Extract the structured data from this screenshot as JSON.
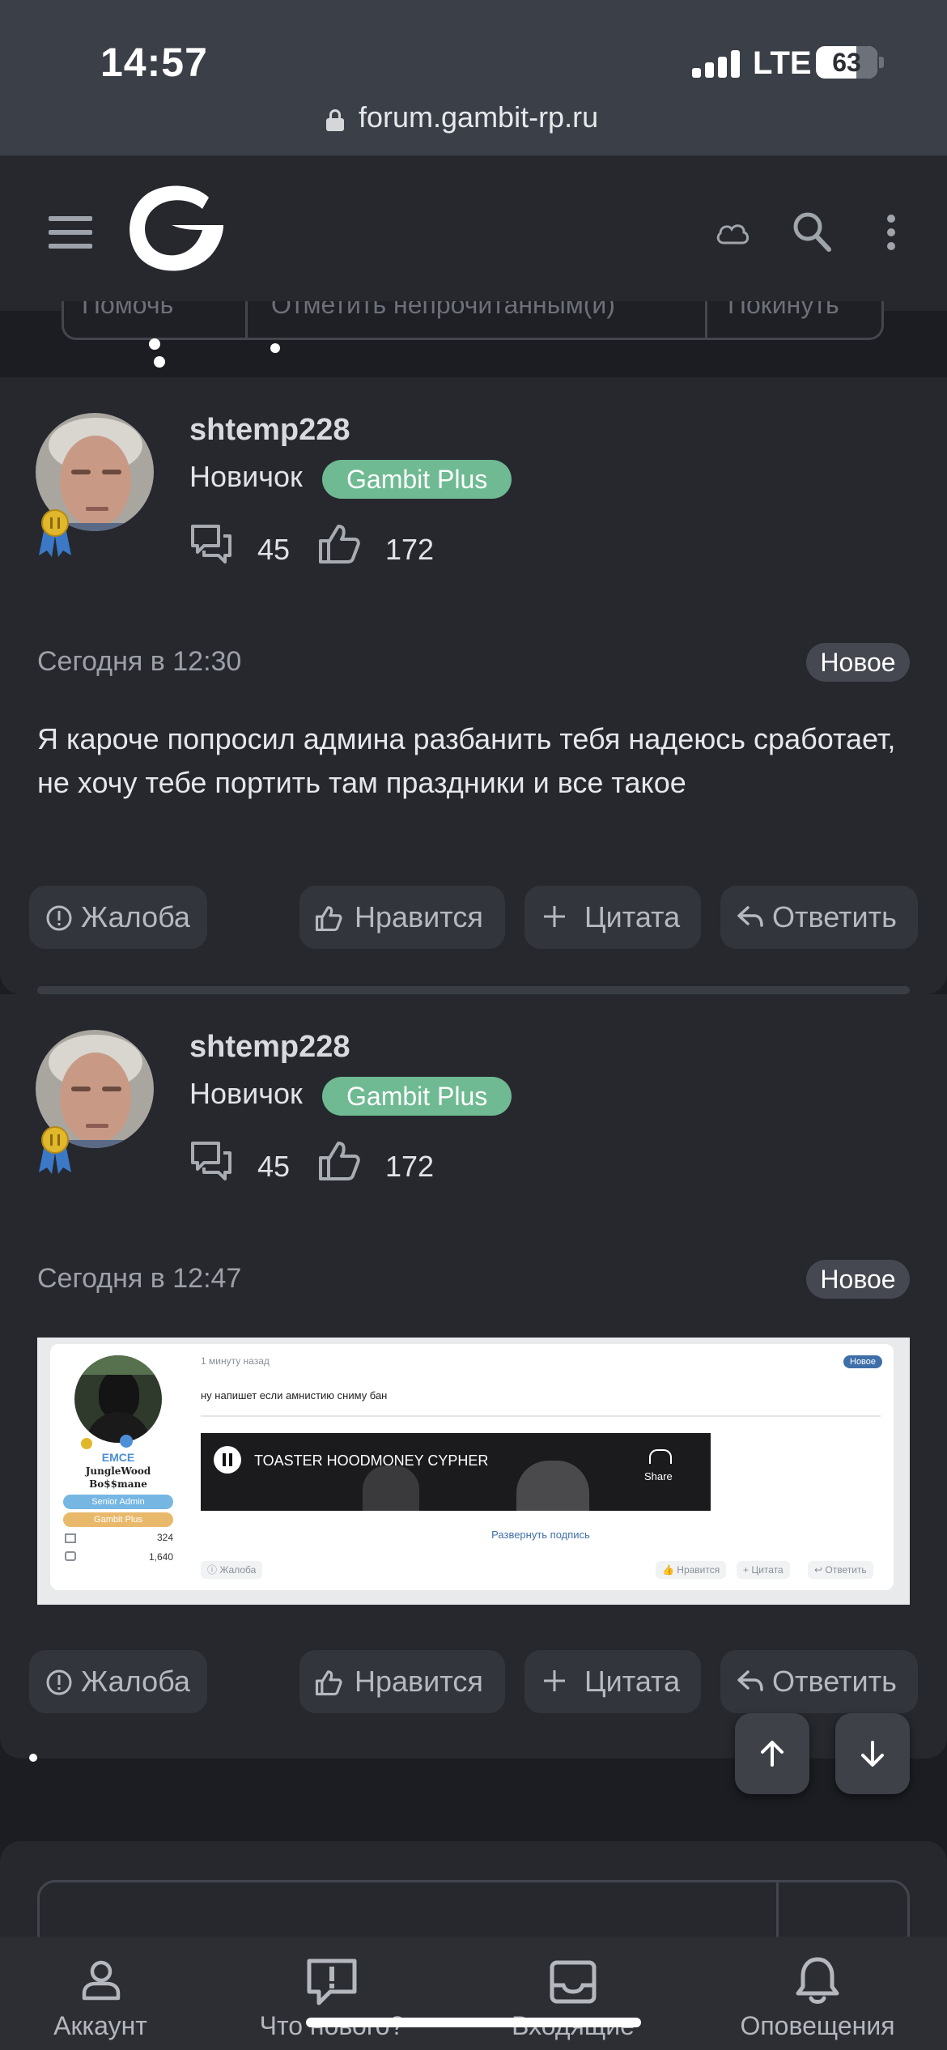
{
  "status_bar": {
    "time": "14:57",
    "network": "LTE",
    "battery": "63",
    "url": "forum.gambit-rp.ru"
  },
  "partial_toolbar": {
    "items": [
      "Помочь",
      "Отметить непрочитанным(и)",
      "Покинуть"
    ]
  },
  "posts": [
    {
      "username": "shtemp228",
      "rank": "Новичок",
      "badge": "Gambit Plus",
      "messages": "45",
      "reactions": "172",
      "date": "Сегодня в 12:30",
      "new_label": "Новое",
      "text": "Я кароче попросил админа разбанить тебя надеюсь сработает, не хочу тебе портить там праздники и все такое"
    },
    {
      "username": "shtemp228",
      "rank": "Новичок",
      "badge": "Gambit Plus",
      "messages": "45",
      "reactions": "172",
      "date": "Сегодня в 12:47",
      "new_label": "Новое",
      "attachment": {
        "username": "EMCE",
        "title_line1": "JungleWood",
        "title_line2": "Bo$$mane",
        "role1": "Senior Admin",
        "role2": "Gambit Plus",
        "messages": "324",
        "reactions": "1,640",
        "date": "1 минуту назад",
        "new_label": "Новое",
        "text": "ну напишет если амнистию сниму бан",
        "video_title": "TOASTER HOODMONEY CYPHER",
        "video_share": "Share",
        "expand_link": "Развернуть подпись",
        "report": "Жалоба",
        "like": "Нравится",
        "quote": "Цитата",
        "reply": "Ответить"
      }
    }
  ],
  "actions": {
    "report": "Жалоба",
    "like": "Нравится",
    "quote": "Цитата",
    "reply": "Ответить"
  },
  "tabbar": {
    "account": "Аккаунт",
    "whats_new": "Что нового?",
    "inbox": "Входящие",
    "alerts": "Оповещения"
  },
  "colors": {
    "background": "#1c1d22",
    "card": "#26282e",
    "badge_green": "#6fba92",
    "muted_text": "#9da0a8"
  }
}
